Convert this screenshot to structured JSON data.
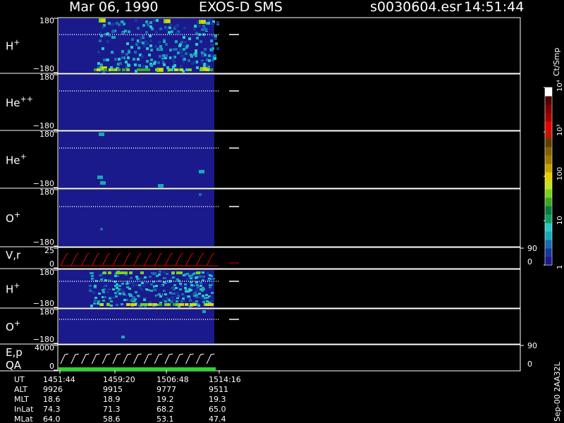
{
  "header": {
    "date": "Mar 06, 1990",
    "instrument": "EXOS-D SMS",
    "file": "s0030604.esr",
    "time": "14:51:44"
  },
  "side_label": "Sep-00 2AA32L",
  "colorbar": {
    "unit": "Ct/Smp",
    "ticks": [
      {
        "label": "1",
        "v": 1
      },
      {
        "label": "10",
        "v": 10
      },
      {
        "label": "100",
        "v": 100
      },
      {
        "label": "10³",
        "v": 1000
      },
      {
        "label": "10⁴",
        "v": 10000
      }
    ],
    "colors": [
      "#1a1a8c",
      "#16389c",
      "#1a6ab0",
      "#19a8b8",
      "#2bc8c8",
      "#10a060",
      "#0d7a40",
      "#3aa820",
      "#7ad020",
      "#c8e020",
      "#e8d000",
      "#c8a000",
      "#a07800",
      "#806000",
      "#603c00",
      "#c01800",
      "#e80000",
      "#a00000",
      "#7a0000",
      "#500000",
      "#ffffff"
    ]
  },
  "panels": [
    {
      "key": "Hp1",
      "name": "H",
      "sup": "+",
      "ytop": "180",
      "ybot": "−180"
    },
    {
      "key": "Hepp",
      "name": "He",
      "sup": "++",
      "ytop": "180",
      "ybot": "−180"
    },
    {
      "key": "Hep",
      "name": "He",
      "sup": "+",
      "ytop": "180",
      "ybot": "−180"
    },
    {
      "key": "Op1",
      "name": "O",
      "sup": "+",
      "ytop": "180",
      "ybot": "−180"
    },
    {
      "key": "Vr",
      "name": "V,r",
      "sup": "",
      "ytop": "25",
      "ybot": "0",
      "right_top": "90",
      "right_bot": "0"
    },
    {
      "key": "Hp2",
      "name": "H",
      "sup": "+",
      "ytop": "180",
      "ybot": "−180"
    },
    {
      "key": "Op2",
      "name": "O",
      "sup": "+",
      "ytop": "180",
      "ybot": "−180"
    },
    {
      "key": "Ep",
      "name": "E,p",
      "sup": "",
      "name2": "QA",
      "ytop": "4000",
      "ybot": "0",
      "right_top": "90",
      "right_bot": "0"
    }
  ],
  "ephemeris": {
    "rows": [
      "UT",
      "ALT",
      "MLT",
      "InLat",
      "MLat"
    ],
    "columns": [
      {
        "UT": "1451:44",
        "ALT": "9926",
        "MLT": "18.6",
        "InLat": "74.3",
        "MLat": "64.0"
      },
      {
        "UT": "1459:20",
        "ALT": "9915",
        "MLT": "18.9",
        "InLat": "71.3",
        "MLat": "58.6"
      },
      {
        "UT": "1506:48",
        "ALT": "9777",
        "MLT": "19.2",
        "InLat": "68.2",
        "MLat": "53.1"
      },
      {
        "UT": "1514:16",
        "ALT": "9511",
        "MLT": "19.3",
        "InLat": "65.0",
        "MLat": "47.4"
      }
    ]
  },
  "chart_data": {
    "type": "heatmap",
    "x_labels": [
      "1451:44",
      "1459:20",
      "1506:48",
      "1514:16"
    ],
    "y_range": [
      -180,
      180
    ],
    "colorscale": "log",
    "colorbar_range": [
      1,
      10000
    ],
    "colorbar_unit": "Ct/Smp",
    "panels": [
      "H+",
      "He++",
      "He+",
      "O+",
      "V,r",
      "H+",
      "O+",
      "E,p / QA"
    ]
  }
}
